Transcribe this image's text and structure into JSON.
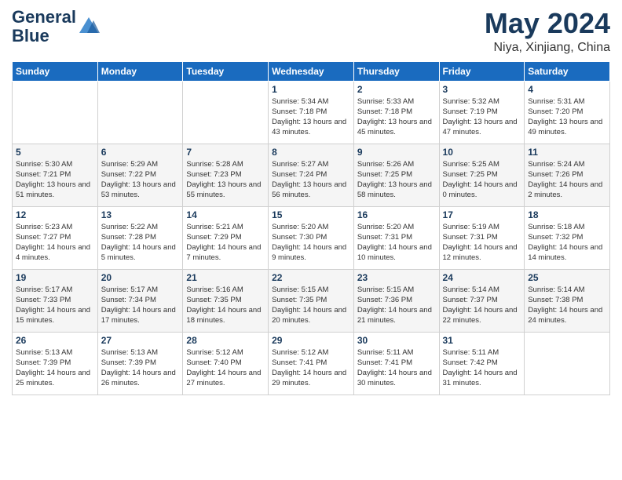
{
  "header": {
    "logo_line1": "General",
    "logo_line2": "Blue",
    "month": "May 2024",
    "location": "Niya, Xinjiang, China"
  },
  "weekdays": [
    "Sunday",
    "Monday",
    "Tuesday",
    "Wednesday",
    "Thursday",
    "Friday",
    "Saturday"
  ],
  "weeks": [
    [
      {
        "day": "",
        "sunrise": "",
        "sunset": "",
        "daylight": ""
      },
      {
        "day": "",
        "sunrise": "",
        "sunset": "",
        "daylight": ""
      },
      {
        "day": "",
        "sunrise": "",
        "sunset": "",
        "daylight": ""
      },
      {
        "day": "1",
        "sunrise": "Sunrise: 5:34 AM",
        "sunset": "Sunset: 7:18 PM",
        "daylight": "Daylight: 13 hours and 43 minutes."
      },
      {
        "day": "2",
        "sunrise": "Sunrise: 5:33 AM",
        "sunset": "Sunset: 7:18 PM",
        "daylight": "Daylight: 13 hours and 45 minutes."
      },
      {
        "day": "3",
        "sunrise": "Sunrise: 5:32 AM",
        "sunset": "Sunset: 7:19 PM",
        "daylight": "Daylight: 13 hours and 47 minutes."
      },
      {
        "day": "4",
        "sunrise": "Sunrise: 5:31 AM",
        "sunset": "Sunset: 7:20 PM",
        "daylight": "Daylight: 13 hours and 49 minutes."
      }
    ],
    [
      {
        "day": "5",
        "sunrise": "Sunrise: 5:30 AM",
        "sunset": "Sunset: 7:21 PM",
        "daylight": "Daylight: 13 hours and 51 minutes."
      },
      {
        "day": "6",
        "sunrise": "Sunrise: 5:29 AM",
        "sunset": "Sunset: 7:22 PM",
        "daylight": "Daylight: 13 hours and 53 minutes."
      },
      {
        "day": "7",
        "sunrise": "Sunrise: 5:28 AM",
        "sunset": "Sunset: 7:23 PM",
        "daylight": "Daylight: 13 hours and 55 minutes."
      },
      {
        "day": "8",
        "sunrise": "Sunrise: 5:27 AM",
        "sunset": "Sunset: 7:24 PM",
        "daylight": "Daylight: 13 hours and 56 minutes."
      },
      {
        "day": "9",
        "sunrise": "Sunrise: 5:26 AM",
        "sunset": "Sunset: 7:25 PM",
        "daylight": "Daylight: 13 hours and 58 minutes."
      },
      {
        "day": "10",
        "sunrise": "Sunrise: 5:25 AM",
        "sunset": "Sunset: 7:25 PM",
        "daylight": "Daylight: 14 hours and 0 minutes."
      },
      {
        "day": "11",
        "sunrise": "Sunrise: 5:24 AM",
        "sunset": "Sunset: 7:26 PM",
        "daylight": "Daylight: 14 hours and 2 minutes."
      }
    ],
    [
      {
        "day": "12",
        "sunrise": "Sunrise: 5:23 AM",
        "sunset": "Sunset: 7:27 PM",
        "daylight": "Daylight: 14 hours and 4 minutes."
      },
      {
        "day": "13",
        "sunrise": "Sunrise: 5:22 AM",
        "sunset": "Sunset: 7:28 PM",
        "daylight": "Daylight: 14 hours and 5 minutes."
      },
      {
        "day": "14",
        "sunrise": "Sunrise: 5:21 AM",
        "sunset": "Sunset: 7:29 PM",
        "daylight": "Daylight: 14 hours and 7 minutes."
      },
      {
        "day": "15",
        "sunrise": "Sunrise: 5:20 AM",
        "sunset": "Sunset: 7:30 PM",
        "daylight": "Daylight: 14 hours and 9 minutes."
      },
      {
        "day": "16",
        "sunrise": "Sunrise: 5:20 AM",
        "sunset": "Sunset: 7:31 PM",
        "daylight": "Daylight: 14 hours and 10 minutes."
      },
      {
        "day": "17",
        "sunrise": "Sunrise: 5:19 AM",
        "sunset": "Sunset: 7:31 PM",
        "daylight": "Daylight: 14 hours and 12 minutes."
      },
      {
        "day": "18",
        "sunrise": "Sunrise: 5:18 AM",
        "sunset": "Sunset: 7:32 PM",
        "daylight": "Daylight: 14 hours and 14 minutes."
      }
    ],
    [
      {
        "day": "19",
        "sunrise": "Sunrise: 5:17 AM",
        "sunset": "Sunset: 7:33 PM",
        "daylight": "Daylight: 14 hours and 15 minutes."
      },
      {
        "day": "20",
        "sunrise": "Sunrise: 5:17 AM",
        "sunset": "Sunset: 7:34 PM",
        "daylight": "Daylight: 14 hours and 17 minutes."
      },
      {
        "day": "21",
        "sunrise": "Sunrise: 5:16 AM",
        "sunset": "Sunset: 7:35 PM",
        "daylight": "Daylight: 14 hours and 18 minutes."
      },
      {
        "day": "22",
        "sunrise": "Sunrise: 5:15 AM",
        "sunset": "Sunset: 7:35 PM",
        "daylight": "Daylight: 14 hours and 20 minutes."
      },
      {
        "day": "23",
        "sunrise": "Sunrise: 5:15 AM",
        "sunset": "Sunset: 7:36 PM",
        "daylight": "Daylight: 14 hours and 21 minutes."
      },
      {
        "day": "24",
        "sunrise": "Sunrise: 5:14 AM",
        "sunset": "Sunset: 7:37 PM",
        "daylight": "Daylight: 14 hours and 22 minutes."
      },
      {
        "day": "25",
        "sunrise": "Sunrise: 5:14 AM",
        "sunset": "Sunset: 7:38 PM",
        "daylight": "Daylight: 14 hours and 24 minutes."
      }
    ],
    [
      {
        "day": "26",
        "sunrise": "Sunrise: 5:13 AM",
        "sunset": "Sunset: 7:39 PM",
        "daylight": "Daylight: 14 hours and 25 minutes."
      },
      {
        "day": "27",
        "sunrise": "Sunrise: 5:13 AM",
        "sunset": "Sunset: 7:39 PM",
        "daylight": "Daylight: 14 hours and 26 minutes."
      },
      {
        "day": "28",
        "sunrise": "Sunrise: 5:12 AM",
        "sunset": "Sunset: 7:40 PM",
        "daylight": "Daylight: 14 hours and 27 minutes."
      },
      {
        "day": "29",
        "sunrise": "Sunrise: 5:12 AM",
        "sunset": "Sunset: 7:41 PM",
        "daylight": "Daylight: 14 hours and 29 minutes."
      },
      {
        "day": "30",
        "sunrise": "Sunrise: 5:11 AM",
        "sunset": "Sunset: 7:41 PM",
        "daylight": "Daylight: 14 hours and 30 minutes."
      },
      {
        "day": "31",
        "sunrise": "Sunrise: 5:11 AM",
        "sunset": "Sunset: 7:42 PM",
        "daylight": "Daylight: 14 hours and 31 minutes."
      },
      {
        "day": "",
        "sunrise": "",
        "sunset": "",
        "daylight": ""
      }
    ]
  ]
}
